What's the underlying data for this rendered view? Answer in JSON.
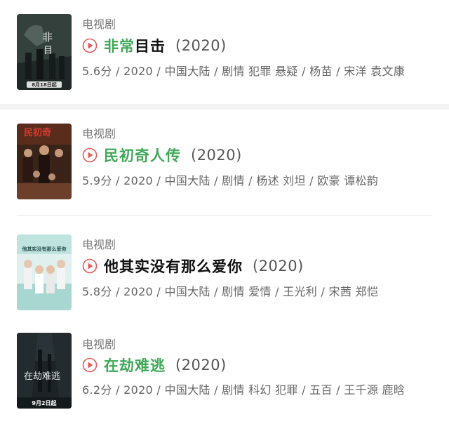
{
  "items": [
    {
      "category": "电视剧",
      "title_hl": "非常",
      "title_rest": "目击",
      "year": "(2020)",
      "meta": "5.6分 / 2020 / 中国大陆 / 剧情 犯罪 悬疑 / 杨苗 / 宋洋 袁文康",
      "poster_caption": "8月18日起"
    },
    {
      "category": "电视剧",
      "title_hl": "民初奇人传",
      "title_rest": "",
      "year": "(2020)",
      "meta": "5.9分 / 2020 / 中国大陆 / 剧情 / 杨述 刘坦 / 欧豪 谭松韵",
      "poster_caption": ""
    },
    {
      "category": "电视剧",
      "title_hl": "",
      "title_rest": "他其实没有那么爱你",
      "year": "(2020)",
      "meta": "5.8分 / 2020 / 中国大陆 / 剧情 爱情 / 王光利 / 宋茜 郑恺",
      "poster_caption": "他其实没有那么爱你"
    },
    {
      "category": "电视剧",
      "title_hl": "在劫难逃",
      "title_rest": "",
      "year": "(2020)",
      "meta": "6.2分 / 2020 / 中国大陆 / 剧情 科幻 犯罪 / 五百 / 王千源 鹿晗",
      "poster_caption": "9月2日起"
    }
  ],
  "colors": {
    "accent": "#40a758",
    "play_icon": "#e05a5a"
  }
}
